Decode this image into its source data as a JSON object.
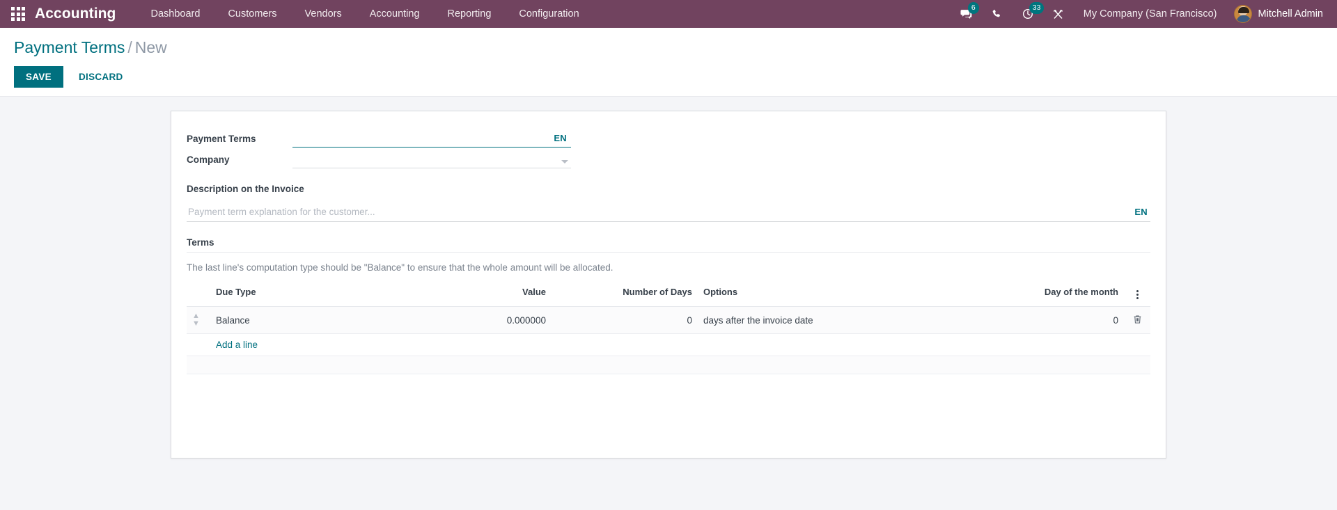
{
  "navbar": {
    "apps_icon": "apps-grid-icon",
    "brand": "Accounting",
    "menu": [
      {
        "label": "Dashboard"
      },
      {
        "label": "Customers"
      },
      {
        "label": "Vendors"
      },
      {
        "label": "Accounting"
      },
      {
        "label": "Reporting"
      },
      {
        "label": "Configuration"
      }
    ],
    "systray": {
      "messages_icon": "chat-bubble-icon",
      "messages_count": "6",
      "phone_icon": "phone-icon",
      "activities_icon": "clock-icon",
      "activities_count": "33",
      "debug_icon": "wrench-icon"
    },
    "company": "My Company (San Francisco)",
    "user": {
      "name": "Mitchell Admin",
      "avatar_icon": "user-avatar"
    },
    "background_color": "#71435f",
    "badge_color": "#00757e"
  },
  "control_panel": {
    "breadcrumb": {
      "root": "Payment Terms",
      "separator": "/",
      "current": "New"
    },
    "save_label": "SAVE",
    "discard_label": "DISCARD",
    "accent_color": "#00707f"
  },
  "form": {
    "fields": {
      "payment_terms": {
        "label": "Payment Terms",
        "value": "",
        "placeholder": "",
        "lang_badge": "EN",
        "focused": true
      },
      "company": {
        "label": "Company",
        "value": "",
        "placeholder": "",
        "dropdown_icon": "chevron-down-icon"
      }
    },
    "description": {
      "label": "Description on the Invoice",
      "value": "",
      "placeholder": "Payment term explanation for the customer...",
      "lang_badge": "EN"
    },
    "terms": {
      "section_label": "Terms",
      "helper_text": "The last line's computation type should be \"Balance\" to ensure that the whole amount will be allocated.",
      "columns": [
        "Due Type",
        "Value",
        "Number of Days",
        "Options",
        "Day of the month"
      ],
      "optional_columns_icon": "kebab-menu-icon",
      "rows": [
        {
          "handle_icon": "drag-handle-icon",
          "due_type": "Balance",
          "value": "0.000000",
          "number_of_days": "0",
          "options": "days after the invoice date",
          "day_of_the_month": "0",
          "delete_icon": "trash-icon"
        }
      ],
      "add_line_label": "Add a line"
    }
  }
}
